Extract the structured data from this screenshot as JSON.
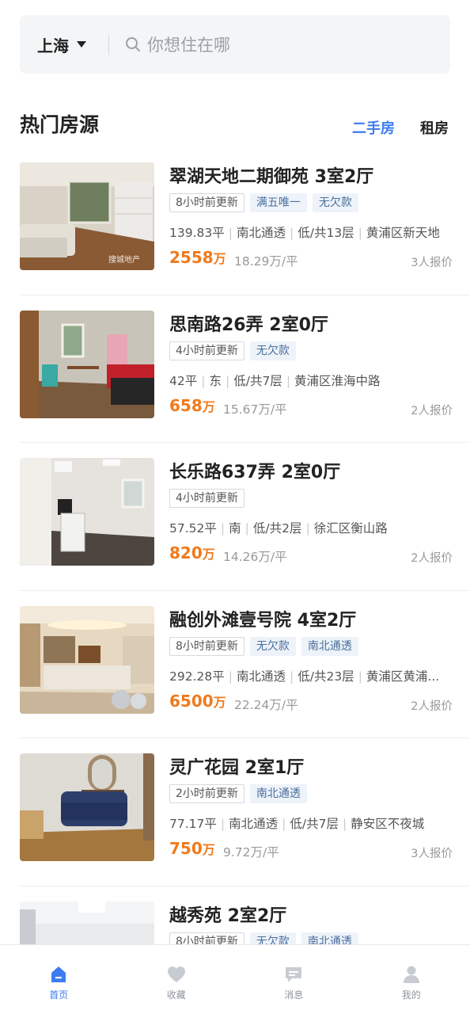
{
  "search": {
    "city": "上海",
    "placeholder": "你想住在哪"
  },
  "section": {
    "title": "热门房源",
    "tabs": [
      "二手房",
      "租房"
    ]
  },
  "listings": [
    {
      "title": "翠湖天地二期御苑 3室2厅",
      "tags": [
        "8小时前更新",
        "满五唯一",
        "无欠款"
      ],
      "meta": [
        "139.83平",
        "南北通透",
        "低/共13层",
        "黄浦区新天地"
      ],
      "price": "2558",
      "price_unit": "万",
      "per_sqm": "18.29万/平",
      "offers": "3人报价",
      "photo": "living-room",
      "watermark": "搜城地产"
    },
    {
      "title": "思南路26弄 2室0厅",
      "tags": [
        "4小时前更新",
        "无欠款"
      ],
      "meta": [
        "42平",
        "东",
        "低/共7层",
        "黄浦区淮海中路"
      ],
      "price": "658",
      "price_unit": "万",
      "per_sqm": "15.67万/平",
      "offers": "2人报价",
      "photo": "bedroom"
    },
    {
      "title": "长乐路637弄 2室0厅",
      "tags": [
        "4小时前更新"
      ],
      "meta": [
        "57.52平",
        "南",
        "低/共2层",
        "徐汇区衡山路"
      ],
      "price": "820",
      "price_unit": "万",
      "per_sqm": "14.26万/平",
      "offers": "2人报价",
      "photo": "empty-room"
    },
    {
      "title": "融创外滩壹号院 4室2厅",
      "tags": [
        "8小时前更新",
        "无欠款",
        "南北通透"
      ],
      "meta": [
        "292.28平",
        "南北通透",
        "低/共23层",
        "黄浦区黄浦..."
      ],
      "price": "6500",
      "price_unit": "万",
      "per_sqm": "22.24万/平",
      "offers": "2人报价",
      "photo": "luxury-room"
    },
    {
      "title": "灵广花园 2室1厅",
      "tags": [
        "2小时前更新",
        "南北通透"
      ],
      "meta": [
        "77.17平",
        "南北通透",
        "低/共7层",
        "静安区不夜城"
      ],
      "price": "750",
      "price_unit": "万",
      "per_sqm": "9.72万/平",
      "offers": "3人报价",
      "photo": "sofa-room"
    },
    {
      "title": "越秀苑 2室2厅",
      "tags": [
        "8小时前更新",
        "无欠款",
        "南北通透"
      ],
      "meta": [],
      "price": "",
      "price_unit": "",
      "per_sqm": "",
      "offers": "",
      "photo": "ceiling-room"
    }
  ],
  "tabbar": [
    {
      "label": "首页",
      "icon": "home-icon",
      "active": true
    },
    {
      "label": "收藏",
      "icon": "heart-icon",
      "active": false
    },
    {
      "label": "消息",
      "icon": "message-icon",
      "active": false
    },
    {
      "label": "我的",
      "icon": "user-icon",
      "active": false
    }
  ],
  "colors": {
    "accent": "#3c7cf0",
    "price": "#f07a1c",
    "tag_bg": "#eef3fa"
  }
}
